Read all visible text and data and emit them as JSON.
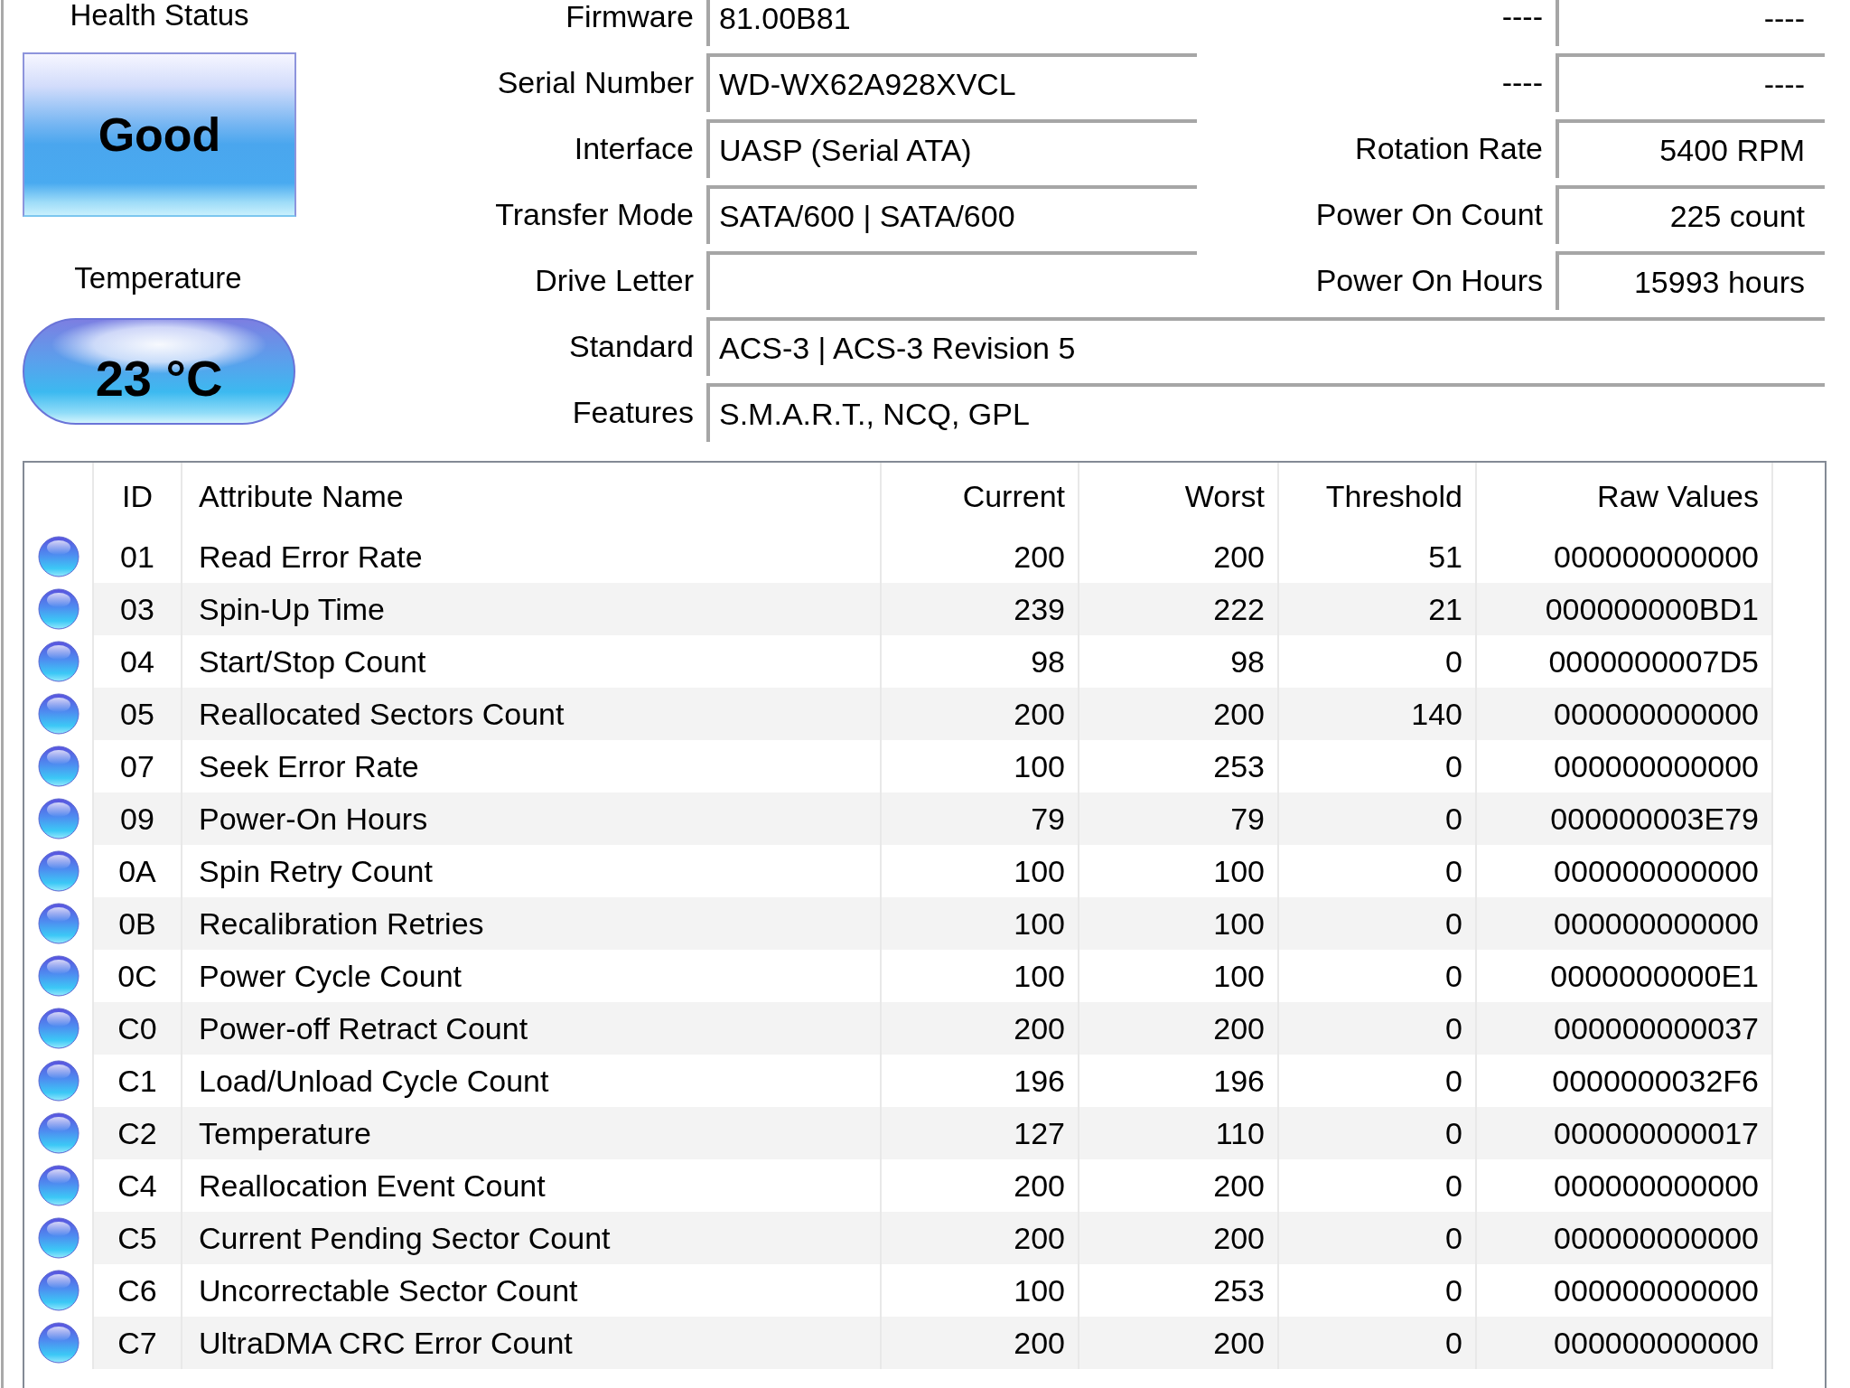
{
  "health": {
    "label": "Health Status",
    "value": "Good"
  },
  "temperature": {
    "label": "Temperature",
    "value": "23 °C"
  },
  "info": {
    "left": [
      {
        "label": "Firmware",
        "value": "81.00B81"
      },
      {
        "label": "Serial Number",
        "value": "WD-WX62A928XVCL"
      },
      {
        "label": "Interface",
        "value": "UASP (Serial ATA)"
      },
      {
        "label": "Transfer Mode",
        "value": "SATA/600 | SATA/600"
      },
      {
        "label": "Drive Letter"
      }
    ],
    "right": [
      {
        "label": "----",
        "value": "----"
      },
      {
        "label": "----",
        "value": "----"
      },
      {
        "label": "Rotation Rate",
        "value": "5400 RPM"
      },
      {
        "label": "Power On Count",
        "value": "225 count"
      },
      {
        "label": "Power On Hours",
        "value": "15993 hours"
      }
    ],
    "wide": [
      {
        "label": "Standard",
        "value": "ACS-3 | ACS-3 Revision 5"
      },
      {
        "label": "Features",
        "value": "S.M.A.R.T., NCQ, GPL"
      }
    ]
  },
  "smart_table": {
    "columns": [
      "ID",
      "Attribute Name",
      "Current",
      "Worst",
      "Threshold",
      "Raw Values"
    ],
    "rows": [
      {
        "id": "01",
        "name": "Read Error Rate",
        "current": "200",
        "worst": "200",
        "threshold": "51",
        "raw": "000000000000"
      },
      {
        "id": "03",
        "name": "Spin-Up Time",
        "current": "239",
        "worst": "222",
        "threshold": "21",
        "raw": "000000000BD1"
      },
      {
        "id": "04",
        "name": "Start/Stop Count",
        "current": "98",
        "worst": "98",
        "threshold": "0",
        "raw": "0000000007D5"
      },
      {
        "id": "05",
        "name": "Reallocated Sectors Count",
        "current": "200",
        "worst": "200",
        "threshold": "140",
        "raw": "000000000000"
      },
      {
        "id": "07",
        "name": "Seek Error Rate",
        "current": "100",
        "worst": "253",
        "threshold": "0",
        "raw": "000000000000"
      },
      {
        "id": "09",
        "name": "Power-On Hours",
        "current": "79",
        "worst": "79",
        "threshold": "0",
        "raw": "000000003E79"
      },
      {
        "id": "0A",
        "name": "Spin Retry Count",
        "current": "100",
        "worst": "100",
        "threshold": "0",
        "raw": "000000000000"
      },
      {
        "id": "0B",
        "name": "Recalibration Retries",
        "current": "100",
        "worst": "100",
        "threshold": "0",
        "raw": "000000000000"
      },
      {
        "id": "0C",
        "name": "Power Cycle Count",
        "current": "100",
        "worst": "100",
        "threshold": "0",
        "raw": "0000000000E1"
      },
      {
        "id": "C0",
        "name": "Power-off Retract Count",
        "current": "200",
        "worst": "200",
        "threshold": "0",
        "raw": "000000000037"
      },
      {
        "id": "C1",
        "name": "Load/Unload Cycle Count",
        "current": "196",
        "worst": "196",
        "threshold": "0",
        "raw": "0000000032F6"
      },
      {
        "id": "C2",
        "name": "Temperature",
        "current": "127",
        "worst": "110",
        "threshold": "0",
        "raw": "000000000017"
      },
      {
        "id": "C4",
        "name": "Reallocation Event Count",
        "current": "200",
        "worst": "200",
        "threshold": "0",
        "raw": "000000000000"
      },
      {
        "id": "C5",
        "name": "Current Pending Sector Count",
        "current": "200",
        "worst": "200",
        "threshold": "0",
        "raw": "000000000000"
      },
      {
        "id": "C6",
        "name": "Uncorrectable Sector Count",
        "current": "100",
        "worst": "253",
        "threshold": "0",
        "raw": "000000000000"
      },
      {
        "id": "C7",
        "name": "UltraDMA CRC Error Count",
        "current": "200",
        "worst": "200",
        "threshold": "0",
        "raw": "000000000000"
      }
    ]
  }
}
